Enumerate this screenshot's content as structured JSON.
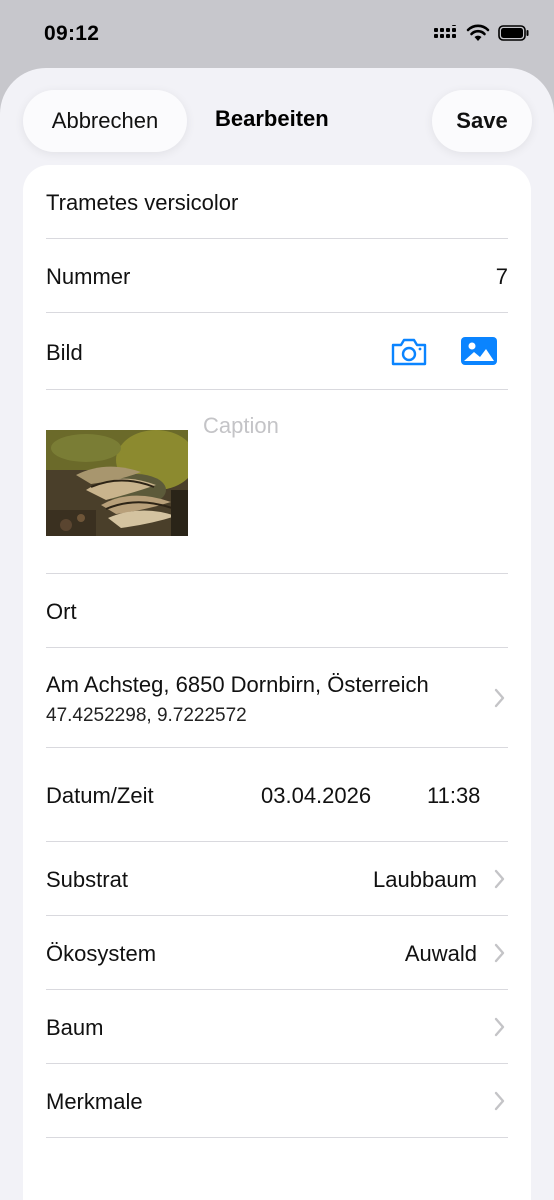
{
  "status": {
    "time": "09:12"
  },
  "nav": {
    "cancel": "Abbrechen",
    "title": "Bearbeiten",
    "save": "Save"
  },
  "form": {
    "name": "Trametes versicolor",
    "number_label": "Nummer",
    "number_value": "7",
    "image_label": "Bild",
    "caption_placeholder": "Caption",
    "location_label": "Ort",
    "address": "Am Achsteg, 6850 Dornbirn, Österreich",
    "coordinates": "47.4252298, 9.7222572",
    "datetime_label": "Datum/Zeit",
    "date": "03.04.2026",
    "time": "11:38",
    "substrate_label": "Substrat",
    "substrate_value": "Laubbaum",
    "ecosystem_label": "Ökosystem",
    "ecosystem_value": "Auwald",
    "tree_label": "Baum",
    "features_label": "Merkmale"
  },
  "colors": {
    "accent": "#0a84ff",
    "separator": "#d9d9de",
    "placeholder": "#c4c4c7"
  },
  "icons": [
    "signal-icon",
    "wifi-icon",
    "battery-icon",
    "camera-icon",
    "photo-library-icon",
    "chevron-right-icon"
  ]
}
